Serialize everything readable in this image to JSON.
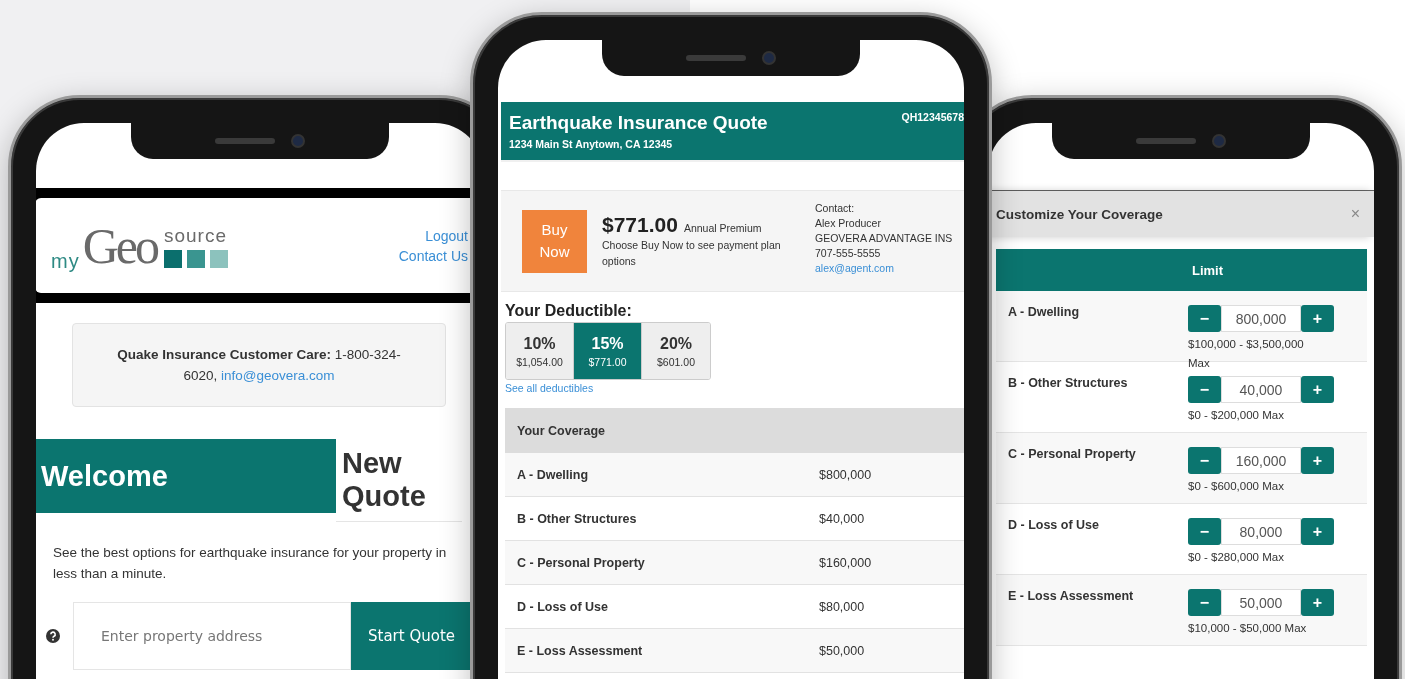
{
  "left_phone": {
    "header": {
      "logo": {
        "prefix": "my",
        "main": "Geo",
        "suffix": "source"
      },
      "links": [
        "Logout",
        "Contact Us"
      ]
    },
    "care_notice": {
      "text": "**Quake Insurance Customer Care:** 1-800-324-6020,",
      "email": "info@geovera.com"
    },
    "welcome": {
      "title": "Welcome",
      "subtitle": "New Quote"
    },
    "intro": "See the best options for earthquake insurance for your property in less than a minute.",
    "address_field": {
      "placeholder": "Enter property address"
    },
    "start_button": "Start Quote"
  },
  "middle_phone": {
    "quote_header": {
      "title": "Earthquake Insurance Quote",
      "address": "1234 Main St Anytown, CA 12345",
      "quote_id": "QH12345678"
    },
    "premium": {
      "buy_button": "Buy Now",
      "amount": "$771.00",
      "period": "Annual Premium",
      "note": "Choose Buy Now to see payment plan options"
    },
    "contact": {
      "label": "Contact:",
      "name": "Alex Producer",
      "agency": "GEOVERA ADVANTAGE INS",
      "phone": "707-555-5555",
      "email": "alex@agent.com"
    },
    "deductible": {
      "title": "Your Deductible:",
      "options": [
        {
          "percent": "10%",
          "amount": "$1,054.00",
          "selected": false
        },
        {
          "percent": "15%",
          "amount": "$771.00",
          "selected": true
        },
        {
          "percent": "20%",
          "amount": "$601.00",
          "selected": false
        }
      ],
      "link": "See all deductibles"
    },
    "coverage": {
      "header": "Your Coverage",
      "rows": [
        {
          "name": "A - Dwelling",
          "amount": "$800,000"
        },
        {
          "name": "B - Other Structures",
          "amount": "$40,000"
        },
        {
          "name": "C - Personal Property",
          "amount": "$160,000"
        },
        {
          "name": "D - Loss of Use",
          "amount": "$80,000"
        },
        {
          "name": "E - Loss Assessment",
          "amount": "$50,000"
        }
      ]
    }
  },
  "right_phone": {
    "modal": {
      "title": "Customize Your Coverage",
      "close": "×",
      "column": "Limit",
      "rows": [
        {
          "name": "A - Dwelling",
          "minus": "−",
          "value": "800,000",
          "plus": "+",
          "range": "$100,000 - $3,500,000 Max"
        },
        {
          "name": "B - Other Structures",
          "minus": "−",
          "value": "40,000",
          "plus": "+",
          "range": "$0 - $200,000 Max"
        },
        {
          "name": "C - Personal Property",
          "minus": "−",
          "value": "160,000",
          "plus": "+",
          "range": "$0 - $600,000 Max"
        },
        {
          "name": "D - Loss of Use",
          "minus": "−",
          "value": "80,000",
          "plus": "+",
          "range": "$0 - $280,000 Max"
        },
        {
          "name": "E - Loss Assessment",
          "minus": "−",
          "value": "50,000",
          "plus": "+",
          "range": "$10,000 - $50,000 Max"
        }
      ]
    }
  }
}
